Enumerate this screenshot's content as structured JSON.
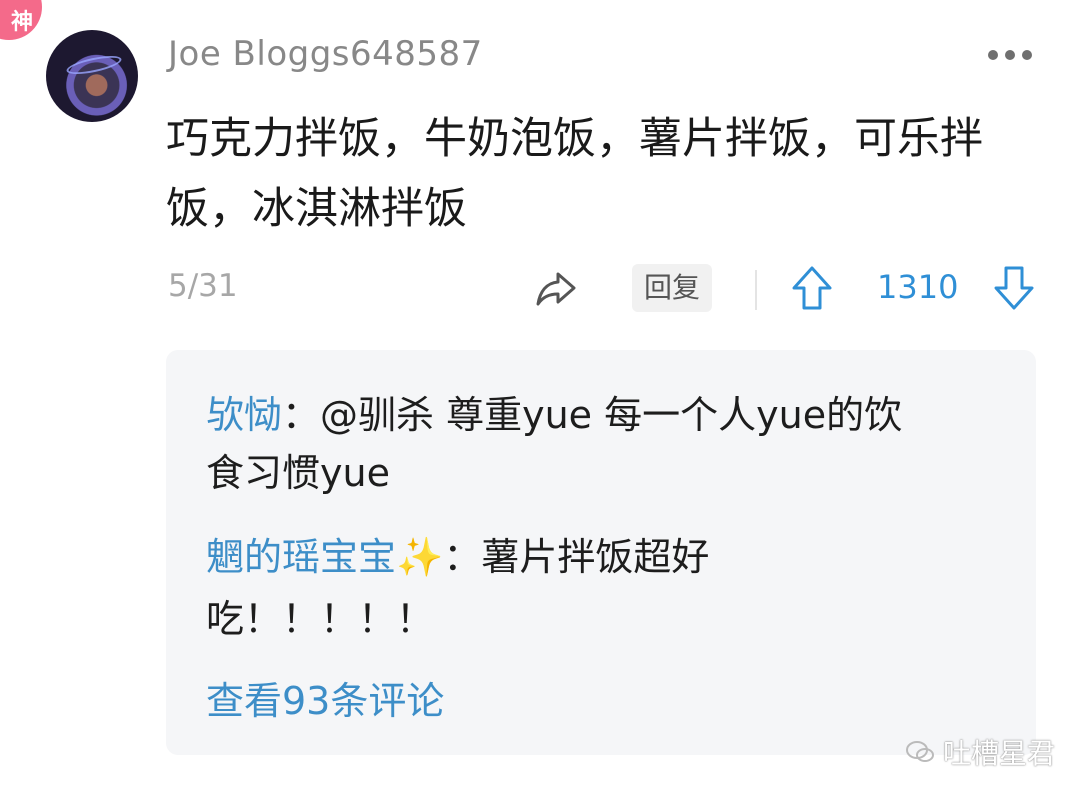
{
  "badge": {
    "label": "神"
  },
  "post": {
    "username": "Joe Bloggs648587",
    "content": "巧克力拌饭，牛奶泡饭，薯片拌饭，可乐拌饭，冰淇淋拌饭",
    "date": "5/31",
    "reply_label": "回复",
    "vote_count": "1310"
  },
  "replies": [
    {
      "name": "欤恸",
      "separator": "：",
      "line1": "@驯杀 尊重yue  每一个人yue的饮",
      "line2": "食习惯yue"
    },
    {
      "name": "魍的瑶宝宝✨",
      "separator": "：",
      "line1": "薯片拌饭超好",
      "line2": "吃！！！！！"
    }
  ],
  "view_more": "查看93条评论",
  "watermark": "吐槽星君",
  "colors": {
    "link": "#3d8ec8",
    "vote": "#2f8fd6",
    "badge": "#f46a8a"
  },
  "icons": [
    "more-icon",
    "share-icon",
    "upvote-icon",
    "downvote-icon",
    "wechat-icon"
  ]
}
